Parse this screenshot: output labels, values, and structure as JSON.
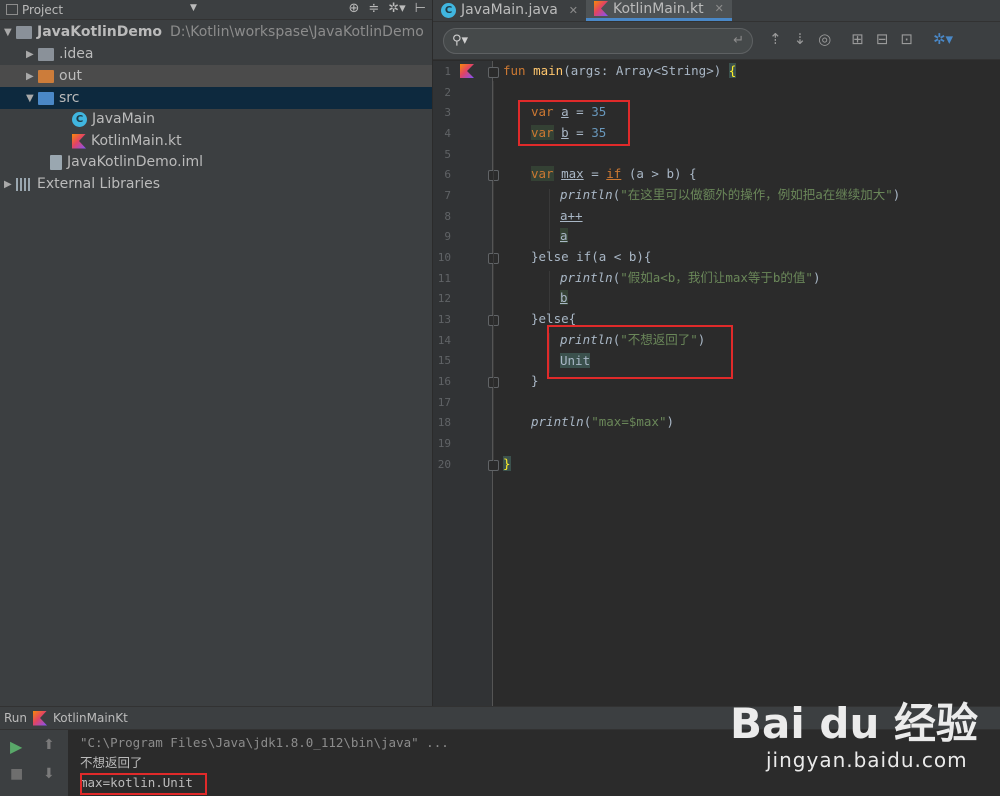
{
  "project_panel": {
    "title": "Project",
    "tree": [
      {
        "label": "JavaKotlinDemo",
        "path": "D:\\Kotlin\\workspase\\JavaKotlinDemo"
      },
      {
        "label": ".idea"
      },
      {
        "label": "out"
      },
      {
        "label": "src"
      },
      {
        "label": "JavaMain"
      },
      {
        "label": "KotlinMain.kt"
      },
      {
        "label": "JavaKotlinDemo.iml"
      },
      {
        "label": "External Libraries"
      }
    ]
  },
  "editor": {
    "tabs": [
      {
        "label": "JavaMain.java",
        "active": false
      },
      {
        "label": "KotlinMain.kt",
        "active": true
      }
    ],
    "search": {
      "placeholder": "",
      "value": ""
    },
    "line_numbers": [
      "1",
      "2",
      "3",
      "4",
      "5",
      "6",
      "7",
      "8",
      "9",
      "10",
      "11",
      "12",
      "13",
      "14",
      "15",
      "16",
      "17",
      "18",
      "19",
      "20"
    ],
    "code": {
      "l1_fun": "fun",
      "l1_main": "main",
      "l1_params": "(args: Array<String>) ",
      "l1_brace": "{",
      "var": "var",
      "l3_a": "a",
      "l3_eq": " = ",
      "l3_val": "35",
      "l4_b": "b",
      "l4_val": "35",
      "l6_max": "max",
      "l6_if": "if",
      "l6_cond": " (a > b) {",
      "println": "println",
      "l7_str": "\"在这里可以做额外的操作，例如把a在继续加大\"",
      "l8": "a++",
      "l9": "a",
      "l10_else": "}else if(",
      "l10_cond": "a < b){",
      "l11_str": "\"假如a<b，我们让max等于b的值\"",
      "l12": "b",
      "l13": "}else{",
      "l14_str": "\"不想返回了\"",
      "l15": "Unit",
      "l16": "}",
      "l18_str": "\"max=$max\"",
      "l20": "}"
    }
  },
  "run_panel": {
    "label": "Run",
    "config": "KotlinMainKt",
    "output": [
      "\"C:\\Program Files\\Java\\jdk1.8.0_112\\bin\\java\" ...",
      "不想返回了",
      "max=kotlin.Unit"
    ]
  },
  "watermark": {
    "logo": "Bai du 经验",
    "site": "jingyan.baidu.com"
  },
  "colors": {
    "background": "#2b2b2b",
    "panel": "#3c3f41",
    "keyword": "#cc7832",
    "number": "#6897bb",
    "string": "#6a8759",
    "function": "#ffc66d",
    "annotation_box": "#e02a2a"
  }
}
